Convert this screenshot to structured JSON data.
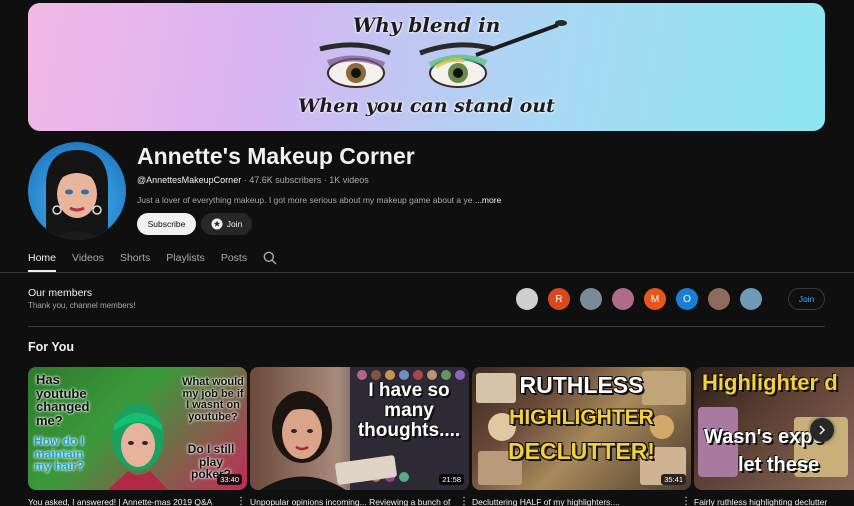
{
  "banner": {
    "line_top": "Why blend in",
    "line_bottom": "When you can stand out"
  },
  "channel": {
    "name": "Annette's Makeup Corner",
    "handle": "@AnnettesMakeupCorner",
    "subscribers": "47.6K subscribers",
    "videos": "1K videos",
    "separator": " · ",
    "description": "Just a lover of everything makeup. I got more serious about my makeup game about a ye",
    "more_label": "...more",
    "subscribe_label": "Subscribe",
    "join_label": "Join"
  },
  "tabs": [
    {
      "label": "Home"
    },
    {
      "label": "Videos"
    },
    {
      "label": "Shorts"
    },
    {
      "label": "Playlists"
    },
    {
      "label": "Posts"
    }
  ],
  "members": {
    "title": "Our members",
    "subtitle": "Thank you, channel members!",
    "avatars": [
      {
        "letter": "",
        "color": "#cfcfcf"
      },
      {
        "letter": "R",
        "color": "#d9481f"
      },
      {
        "letter": "",
        "color": "#7a8a99"
      },
      {
        "letter": "",
        "color": "#b06a8a"
      },
      {
        "letter": "M",
        "color": "#e8561e"
      },
      {
        "letter": "O",
        "color": "#1a7fd4"
      },
      {
        "letter": "",
        "color": "#8c6b5c"
      },
      {
        "letter": "",
        "color": "#6f9ab5"
      }
    ],
    "join_label": "Join"
  },
  "for_you": {
    "title": "For You",
    "videos": [
      {
        "title": "You asked, I answered! | Annette-mas 2019 Q&A",
        "duration": "33:40",
        "thumb_text": [
          "Has youtube changed me?",
          "What would my job be if I wasnt on youtube?",
          "How do I maintain my hair?",
          "Do I still play poker?"
        ]
      },
      {
        "title": "Unpopular opinions incoming... Reviewing a bunch of",
        "duration": "21:58",
        "thumb_text": [
          "I have so many thoughts...."
        ]
      },
      {
        "title": "Decluttering HALF of my highlighters....",
        "duration": "35:41",
        "thumb_text": [
          "RUTHLESS",
          "HIGHLIGHTER",
          "DECLUTTER!"
        ]
      },
      {
        "title": "Fairly ruthless highlighting declutter",
        "duration": "",
        "thumb_text": [
          "Highlighter d",
          "Wasn's expe",
          "let these"
        ]
      }
    ]
  },
  "colors": {
    "background": "#0f0f0f",
    "text": "#f1f1f1",
    "secondary_text": "#aaaaaa",
    "link_blue": "#3ea6ff",
    "chip": "#272727"
  }
}
